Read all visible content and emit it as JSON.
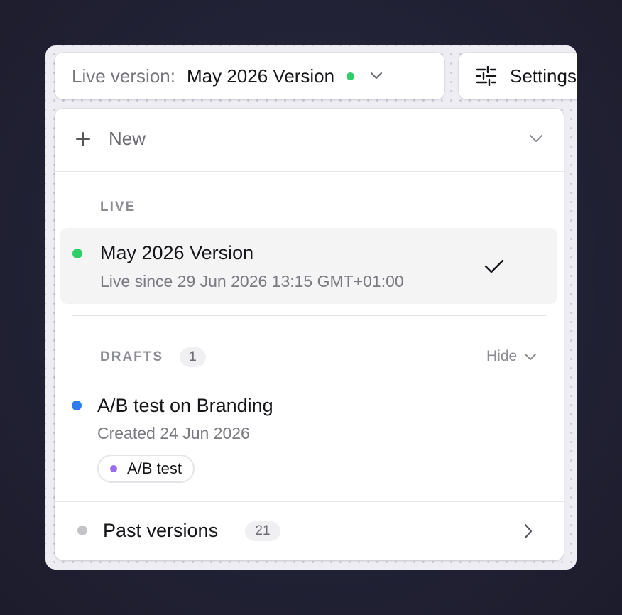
{
  "header": {
    "live_label": "Live version:",
    "live_value": "May 2026 Version",
    "settings_label": "Settings"
  },
  "menu": {
    "new_label": "New",
    "live_section": {
      "heading": "LIVE",
      "item": {
        "title": "May 2026 Version",
        "subtitle": "Live since 29 Jun 2026 13:15 GMT+01:00"
      }
    },
    "drafts_section": {
      "heading": "DRAFTS",
      "count": "1",
      "toggle_label": "Hide",
      "items": [
        {
          "title": "A/B test on Branding",
          "subtitle": "Created 24 Jun 2026",
          "tag": "A/B test"
        }
      ]
    },
    "past": {
      "label": "Past versions",
      "count": "21"
    }
  },
  "colors": {
    "live": "#2fcf68",
    "draft": "#2f7cf0",
    "tag": "#9b6cf3",
    "past": "#c4c4c8"
  },
  "icons": {
    "top_chevron": "chevron-down-icon",
    "settings": "sliders-icon",
    "new": "plus-icon",
    "new_chevron": "chevron-down-icon",
    "selected": "check-icon",
    "hide_chevron": "chevron-down-icon",
    "past_arrow": "chevron-right-icon"
  }
}
